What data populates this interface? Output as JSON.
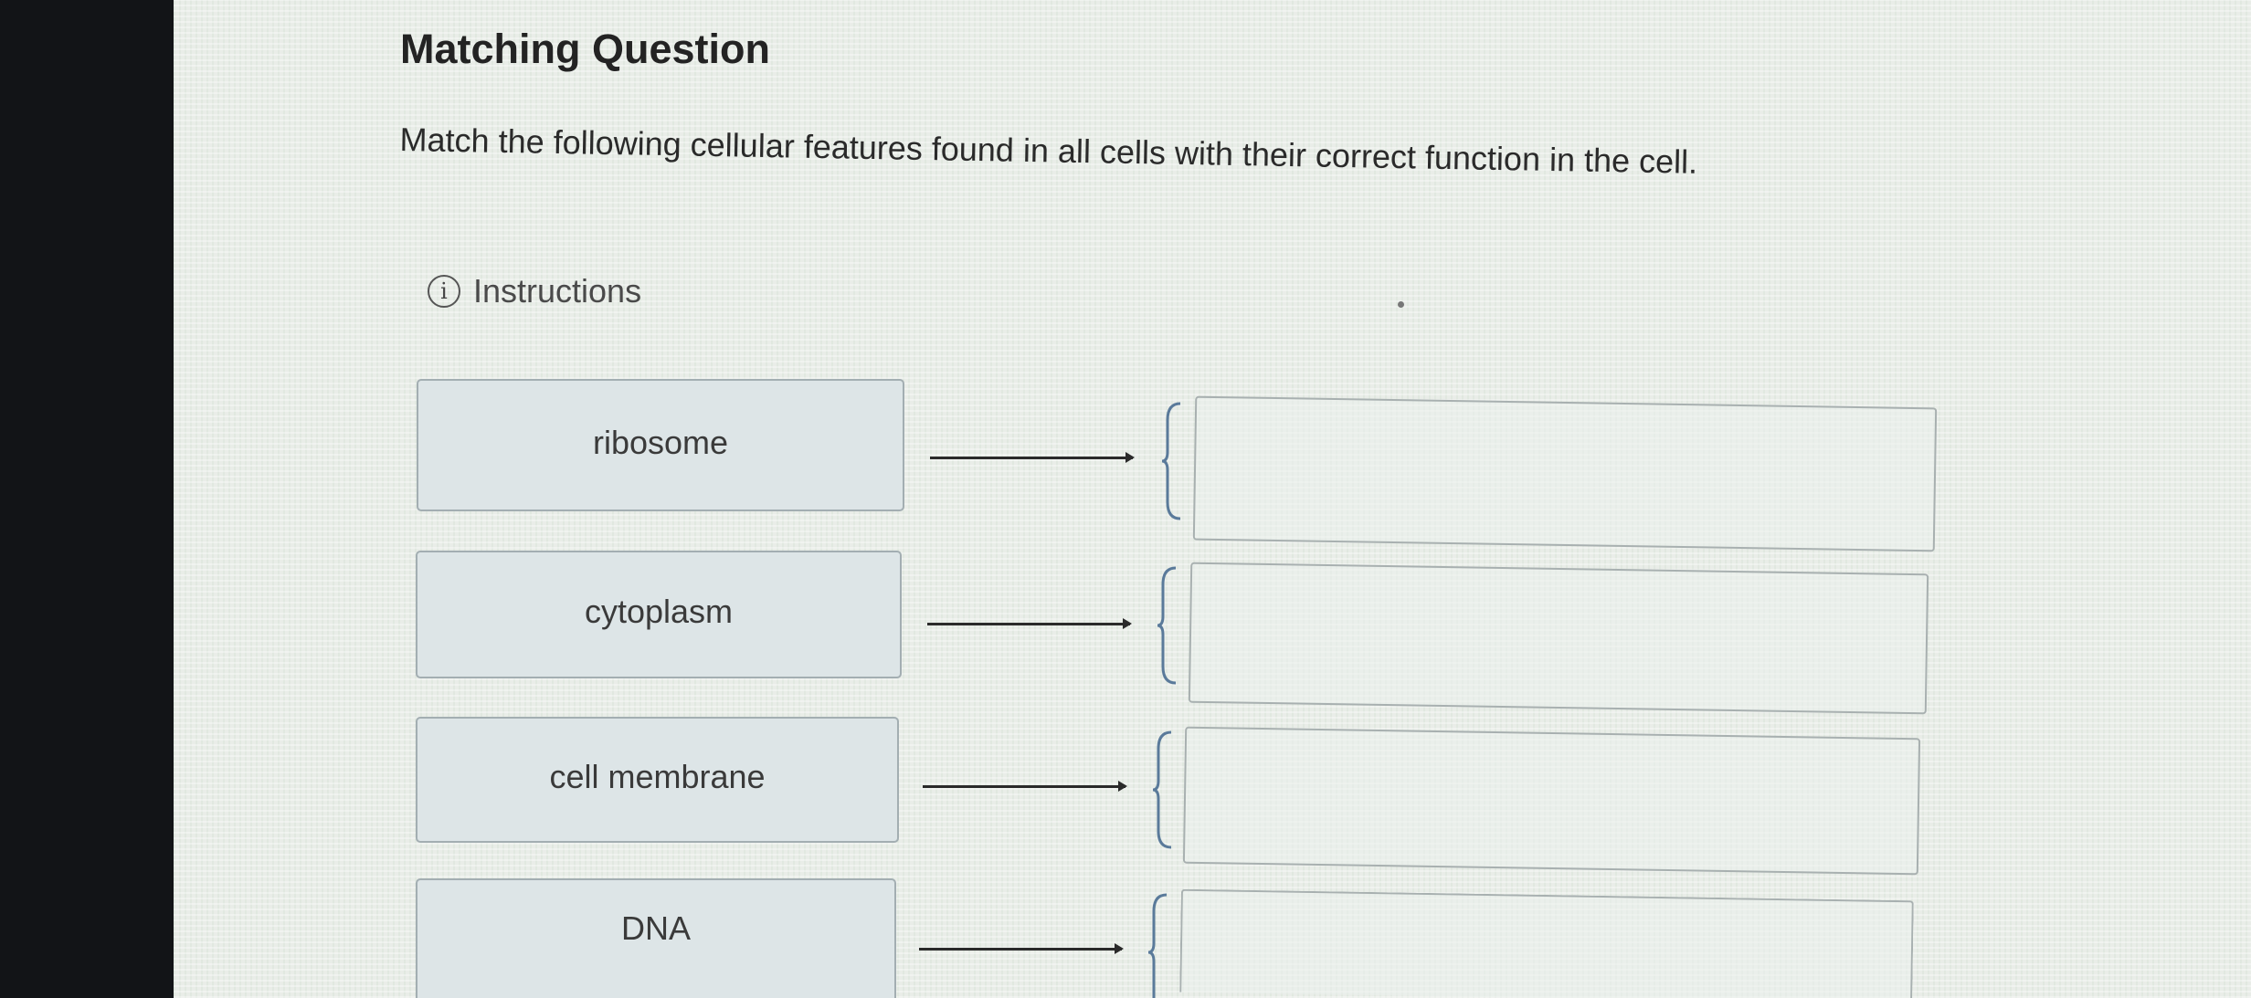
{
  "question": {
    "title": "Matching Question",
    "prompt": "Match the following cellular features found in all cells with their correct function in the cell.",
    "instructions_label": "Instructions",
    "instructions_icon": "info-icon"
  },
  "terms": [
    {
      "label": "ribosome"
    },
    {
      "label": "cytoplasm"
    },
    {
      "label": "cell membrane"
    },
    {
      "label": "DNA"
    }
  ],
  "answers": [
    {
      "value": ""
    },
    {
      "value": ""
    },
    {
      "value": ""
    },
    {
      "value": ""
    }
  ],
  "colors": {
    "brace": "#5a7a9a",
    "term_bg": "#dde5e7",
    "term_border": "#a3aeb2"
  }
}
